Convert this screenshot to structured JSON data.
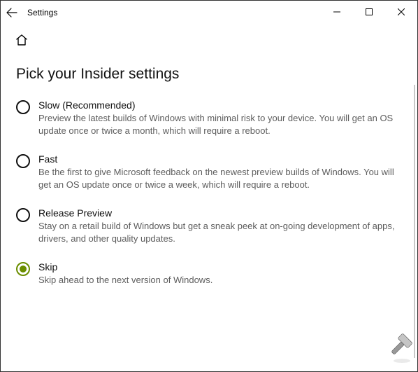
{
  "window": {
    "app_title": "Settings"
  },
  "page": {
    "title": "Pick your Insider settings"
  },
  "options": [
    {
      "title": "Slow (Recommended)",
      "desc": "Preview the latest builds of Windows with minimal risk to your device. You will get an OS update once or twice a month, which will require a reboot.",
      "selected": false
    },
    {
      "title": "Fast",
      "desc": "Be the first to give Microsoft feedback on the newest preview builds of Windows. You will get an OS update once or twice a week, which will require a reboot.",
      "selected": false
    },
    {
      "title": "Release Preview",
      "desc": "Stay on a retail build of Windows but get a sneak peek at on-going development of apps, drivers, and other quality updates.",
      "selected": false
    },
    {
      "title": "Skip",
      "desc": "Skip ahead to the next version of Windows.",
      "selected": true
    }
  ]
}
